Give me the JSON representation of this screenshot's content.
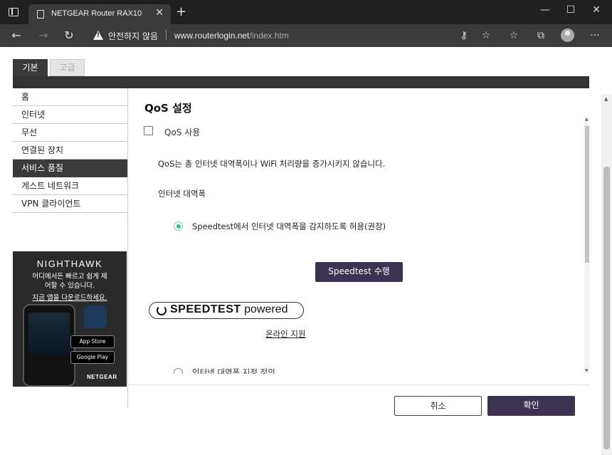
{
  "browser": {
    "tab_title": "NETGEAR Router RAX10",
    "tab_close": "✕",
    "new_tab": "+",
    "security_label": "안전하지 않음",
    "url_host": "www.routerlogin.net",
    "url_path": "/index.htm",
    "window_controls": {
      "minimize": "—",
      "maximize": "☐",
      "close": "✕"
    },
    "nav": {
      "back": "←",
      "forward": "→",
      "refresh": "↻"
    },
    "toolbar_icons": [
      "key-icon",
      "favorite-add-icon",
      "favorites-icon",
      "collections-icon",
      "profile-icon",
      "more-icon"
    ],
    "more": "···"
  },
  "router": {
    "tabs": {
      "basic": "기본",
      "advanced": "고급"
    },
    "sidebar": [
      {
        "label": "홈"
      },
      {
        "label": "인터넷"
      },
      {
        "label": "무선"
      },
      {
        "label": "연결된 장치"
      },
      {
        "label": "서비스 품질",
        "active": true
      },
      {
        "label": "게스트 네트워크"
      },
      {
        "label": "VPN 클라이언트"
      }
    ],
    "promo": {
      "brand": "NIGHTHAWK",
      "line1": "어디에서든 빠르고 쉽게 제",
      "line2": "어할 수 있습니다.",
      "link": "지금 앱을 다운로드하세요.",
      "app_store": "App Store",
      "google_play": "Google Play",
      "logo": "NETGEAR"
    },
    "main": {
      "title": "QoS 설정",
      "enable_label": "QoS 사용",
      "enable_checked": false,
      "note": "QoS는 총 인터넷 대역폭이나 WiFi 처리량을 증가시키지 않습니다.",
      "bandwidth_label": "인터넷 대역폭",
      "option_speedtest": "Speedtest에서 인터넷 대역폭을 감지하도록 허용(권장)",
      "speedtest_button": "Speedtest 수행",
      "speedtest_logo_bold": "SPEEDTEST",
      "speedtest_logo_rest": " powered",
      "online_support": "온라인 지원",
      "option_manual": "인터넷 대역폭 지정 정의"
    },
    "footer": {
      "cancel": "취소",
      "apply": "확인"
    }
  },
  "colors": {
    "accent": "#3c3352",
    "radio_selected": "#2ec27e",
    "dark_bar": "#333333"
  }
}
